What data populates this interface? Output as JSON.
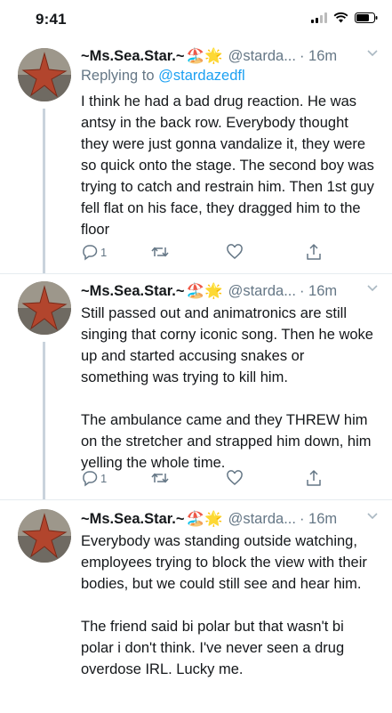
{
  "status": {
    "time": "9:41"
  },
  "colors": {
    "link": "#1da1f2",
    "muted": "#657786",
    "text": "#14171a",
    "thread_line": "#c9d3dc"
  },
  "tweets": [
    {
      "name": "~Ms.Sea.Star.~",
      "emoji": "🏖️🌟",
      "handle": "@starda...",
      "time": "· 16m",
      "reply_prefix": "Replying to",
      "reply_mention": "@stardazedfl",
      "body": "I think he had a bad drug reaction. He was antsy in the back row. Everybody thought they were just gonna vandalize it, they were so quick onto the stage. The second boy was trying to catch and restrain him. Then 1st guy fell flat on his face, they dragged him to the floor",
      "replies": "1"
    },
    {
      "name": "~Ms.Sea.Star.~",
      "emoji": "🏖️🌟",
      "handle": "@starda...",
      "time": "· 16m",
      "body": "Still passed out and animatronics are still singing that corny iconic song. Then he woke up and started accusing snakes or something was trying to kill him.\n\nThe ambulance came and they THREW him on the stretcher and strapped him down, him yelling the whole time.",
      "replies": "1"
    },
    {
      "name": "~Ms.Sea.Star.~",
      "emoji": "🏖️🌟",
      "handle": "@starda...",
      "time": "· 16m",
      "body": "Everybody was standing outside watching, employees trying to block the view with their bodies, but we could still see and hear him.\n\nThe friend said bi polar but that wasn't bi polar i don't think. I've never seen a drug overdose IRL. Lucky me."
    }
  ]
}
